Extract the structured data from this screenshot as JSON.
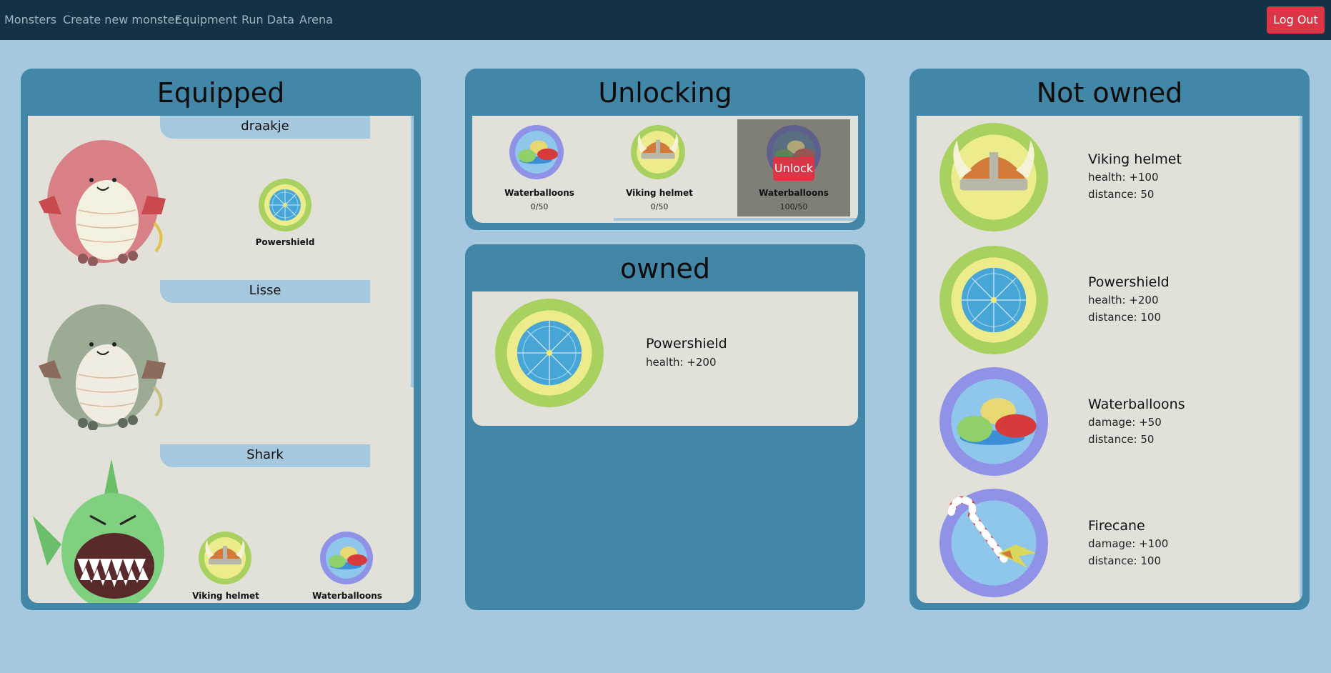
{
  "nav": {
    "links": [
      "Monsters",
      "Create new monster",
      "Equipment",
      "Run Data",
      "Arena"
    ],
    "logout_label": "Log Out"
  },
  "equipped": {
    "title": "Equipped",
    "monsters": [
      {
        "name": "draakje",
        "icon": "pink-dragon-icon",
        "items": [
          {
            "label": "Powershield",
            "icon": "powershield-icon"
          }
        ]
      },
      {
        "name": "Lisse",
        "icon": "green-dragon-icon",
        "items": []
      },
      {
        "name": "Shark",
        "icon": "shark-icon",
        "items": [
          {
            "label": "Viking helmet",
            "icon": "viking-helmet-icon"
          },
          {
            "label": "Waterballoons",
            "icon": "waterballoons-icon"
          }
        ]
      }
    ]
  },
  "unlocking": {
    "title": "Unlocking",
    "items": [
      {
        "label": "Waterballoons",
        "progress": "0/50",
        "icon": "waterballoons-icon"
      },
      {
        "label": "Viking helmet",
        "progress": "0/50",
        "icon": "viking-helmet-icon"
      },
      {
        "label": "Waterballoons",
        "progress": "100/50",
        "icon": "waterballoons-icon",
        "unlock_label": "Unlock"
      }
    ]
  },
  "owned": {
    "title": "owned",
    "items": [
      {
        "label": "Powershield",
        "stats": [
          "health: +200"
        ],
        "icon": "powershield-icon"
      }
    ]
  },
  "not_owned": {
    "title": "Not owned",
    "items": [
      {
        "label": "Viking helmet",
        "stats": [
          "health: +100",
          "distance: 50"
        ],
        "icon": "viking-helmet-icon"
      },
      {
        "label": "Powershield",
        "stats": [
          "health: +200",
          "distance: 100"
        ],
        "icon": "powershield-icon"
      },
      {
        "label": "Waterballoons",
        "stats": [
          "damage: +50",
          "distance: 50"
        ],
        "icon": "waterballoons-icon"
      },
      {
        "label": "Firecane",
        "stats": [
          "damage: +100",
          "distance: 100"
        ],
        "icon": "firecane-icon"
      }
    ]
  },
  "colors": {
    "nav_bg": "#143246",
    "page_bg": "#a5c8de",
    "panel_bg": "#4286a8",
    "card_bg": "#e1e1d9",
    "logout_bg": "#dc3545"
  }
}
